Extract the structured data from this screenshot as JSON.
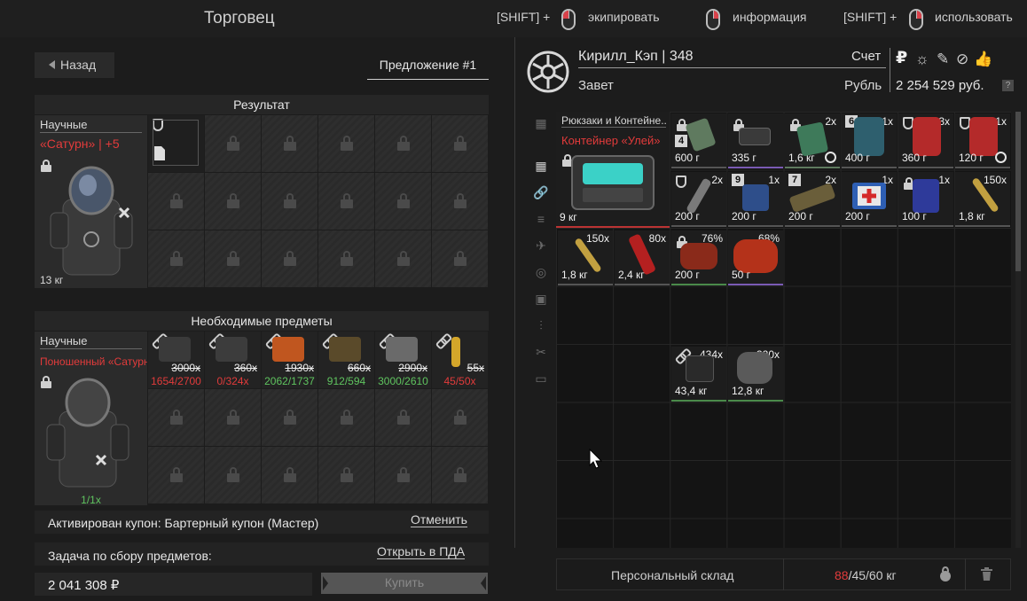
{
  "header": {
    "title": "Торговец",
    "hints": [
      {
        "prefix": "[SHIFT] +",
        "label": "экипировать"
      },
      {
        "prefix": "",
        "label": "информация"
      },
      {
        "prefix": "[SHIFT] +",
        "label": "использовать"
      }
    ]
  },
  "left": {
    "back_label": "Назад",
    "offer_tab": "Предложение #1",
    "result": {
      "title": "Результат",
      "category": "Научные",
      "item_name": "«Сатурн» | +5",
      "weight": "13 кг"
    },
    "required": {
      "title": "Необходимые предметы",
      "category": "Научные",
      "item_name": "Поношенный «Сатурн»",
      "count": "1/1x",
      "items": [
        {
          "need": "3000x",
          "have": "1654/2700",
          "have_color": "#e23b3b",
          "art_color": "#3a3a3a"
        },
        {
          "need": "360x",
          "have": "0/324x",
          "have_color": "#e23b3b",
          "art_color": "#3c3c3c"
        },
        {
          "need": "1930x",
          "have": "2062/1737",
          "have_color": "#5fc45f",
          "art_color": "#c0561f"
        },
        {
          "need": "660x",
          "have": "912/594",
          "have_color": "#5fc45f",
          "art_color": "#5a4a2a"
        },
        {
          "need": "2900x",
          "have": "3000/2610",
          "have_color": "#5fc45f",
          "art_color": "#6a6a6a"
        },
        {
          "need": "55x",
          "have": "45/50x",
          "have_color": "#e23b3b",
          "art_color": "#d4a62a"
        }
      ]
    },
    "coupon": {
      "text": "Активирован купон: Бартерный купон (Мастер)",
      "cancel": "Отменить"
    },
    "task": {
      "text": "Задача по сбору предметов:",
      "link": "Открыть в ПДА"
    },
    "price": "2 041 308 ₽",
    "buy_label": "Купить"
  },
  "right": {
    "player": "Кирилл_Кэп | 348",
    "account_label": "Счет",
    "faction": "Завет",
    "currency_label": "Рубль",
    "balance": "2 254 529 руб.",
    "help": "?",
    "currency_icons": [
      "₽",
      "☼",
      "✎",
      "⊘",
      "👍"
    ],
    "side_tabs": [
      "▦",
      "▦",
      "🔗",
      "≡",
      "✈",
      "◎",
      "▣",
      "⫶",
      "✂",
      "▭"
    ],
    "container": {
      "category": "Рюкзаки и Контейне...",
      "name": "Контейнер «Улей»",
      "weight": "9 кг"
    },
    "items": [
      {
        "w": "600 г",
        "c": "",
        "badge": "4",
        "color": "#5f7a5f"
      },
      {
        "w": "335 г",
        "c": "",
        "badge": "",
        "color": "#3a3a3a"
      },
      {
        "w": "1,6 кг",
        "c": "2x",
        "badge": "",
        "color": "#3e7a5a"
      },
      {
        "w": "400 г",
        "c": "1x",
        "badge": "6",
        "color": "#2e5f6e"
      },
      {
        "w": "360 г",
        "c": "3x",
        "badge": "",
        "color": "#b42a2a"
      },
      {
        "w": "120 г",
        "c": "1x",
        "badge": "",
        "color": "#b42a2a"
      },
      {
        "w": "200 г",
        "c": "2x",
        "badge": "",
        "color": "#7a7a7a"
      },
      {
        "w": "200 г",
        "c": "1x",
        "badge": "9",
        "color": "#2e4e8a"
      },
      {
        "w": "200 г",
        "c": "2x",
        "badge": "7",
        "color": "#6a5e3a"
      },
      {
        "w": "200 г",
        "c": "1x",
        "badge": "",
        "color": "#d8d8d8"
      },
      {
        "w": "100 г",
        "c": "1x",
        "badge": "",
        "color": "#2e3a9a"
      },
      {
        "w": "1,8 кг",
        "c": "150x",
        "badge": "",
        "color": "#c2a040"
      },
      {
        "w": "1,8 кг",
        "c": "150x",
        "badge": "",
        "color": "#c2a040"
      },
      {
        "w": "2,4 кг",
        "c": "80x",
        "badge": "",
        "color": "#b42020"
      },
      {
        "w": "200 г",
        "c": "76%",
        "badge": "",
        "color": "#8a2a1a"
      },
      {
        "w": "50 г",
        "c": "68%",
        "badge": "",
        "color": "#b4321a"
      },
      {
        "w": "43,4 кг",
        "c": "434x",
        "badge": "",
        "color": "#2a2a2a"
      },
      {
        "w": "12,8 кг",
        "c": "320x",
        "badge": "",
        "color": "#5a5a5a"
      }
    ],
    "stash": {
      "label": "Персональный склад",
      "current": "88",
      "rest": "/45/60 кг"
    }
  }
}
